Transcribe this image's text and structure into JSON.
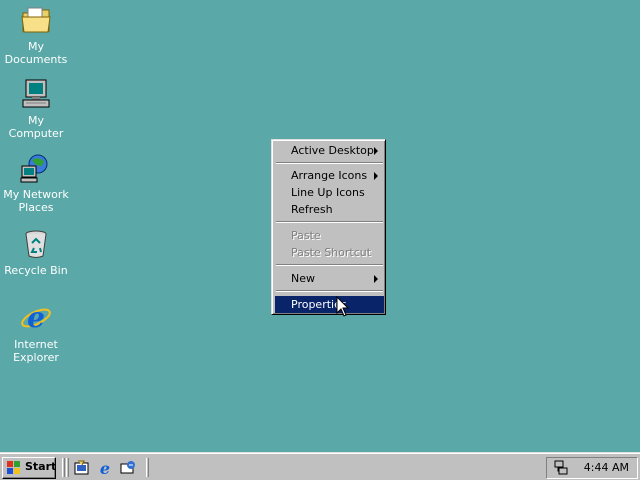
{
  "desktop": {
    "icons": [
      {
        "label": "My Documents",
        "icon": "folder-documents-icon"
      },
      {
        "label": "My Computer",
        "icon": "computer-icon"
      },
      {
        "label": "My Network\nPlaces",
        "label_lines": [
          "My Network",
          "Places"
        ],
        "icon": "network-icon"
      },
      {
        "label": "Recycle Bin",
        "icon": "recycle-bin-icon"
      },
      {
        "label": "Internet\nExplorer",
        "label_lines": [
          "Internet",
          "Explorer"
        ],
        "icon": "internet-explorer-icon"
      }
    ],
    "background_color": "#5aa8a8"
  },
  "context_menu": {
    "items": {
      "active_desktop": "Active Desktop",
      "arrange_icons": "Arrange Icons",
      "line_up_icons": "Line Up Icons",
      "refresh": "Refresh",
      "paste": "Paste",
      "paste_shortcut": "Paste Shortcut",
      "new": "New",
      "properties": "Properties"
    },
    "selected": "Properties",
    "highlight_color": "#0a246a"
  },
  "taskbar": {
    "start_label": "Start",
    "quick_launch": [
      "show-desktop-icon",
      "internet-explorer-icon",
      "outlook-express-icon"
    ],
    "clock": "4:44 AM"
  }
}
